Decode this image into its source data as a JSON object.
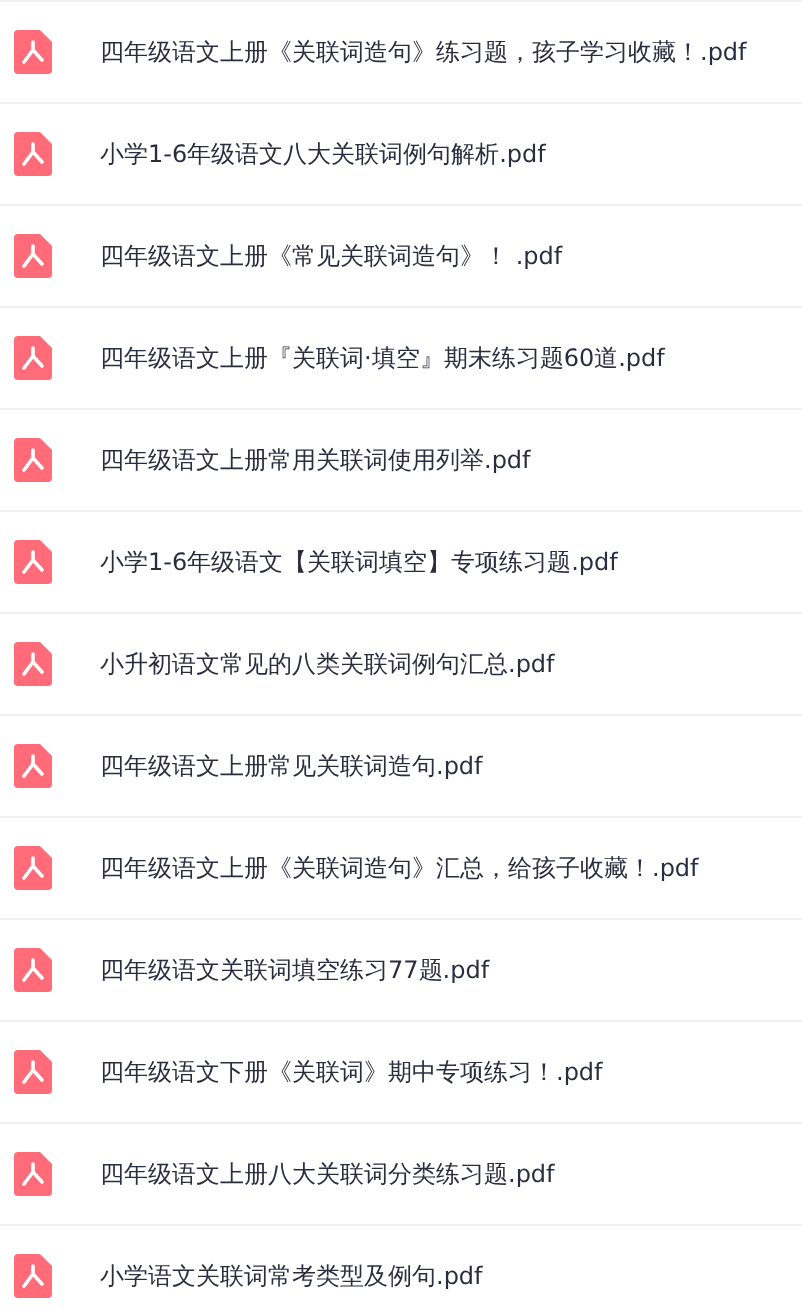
{
  "files": [
    {
      "name": "四年级语文上册《关联词造句》练习题，孩子学习收藏！.pdf"
    },
    {
      "name": "小学1-6年级语文八大关联词例句解析.pdf"
    },
    {
      "name": "四年级语文上册《常见关联词造句》！ .pdf"
    },
    {
      "name": "四年级语文上册『关联词·填空』期末练习题60道.pdf"
    },
    {
      "name": "四年级语文上册常用关联词使用列举.pdf"
    },
    {
      "name": "小学1-6年级语文【关联词填空】专项练习题.pdf"
    },
    {
      "name": "小升初语文常见的八类关联词例句汇总.pdf"
    },
    {
      "name": "四年级语文上册常见关联词造句.pdf"
    },
    {
      "name": "四年级语文上册《关联词造句》汇总，给孩子收藏！.pdf"
    },
    {
      "name": "四年级语文关联词填空练习77题.pdf"
    },
    {
      "name": "四年级语文下册《关联词》期中专项练习！.pdf"
    },
    {
      "name": "四年级语文上册八大关联词分类练习题.pdf"
    },
    {
      "name": "小学语文关联词常考类型及例句.pdf"
    }
  ]
}
